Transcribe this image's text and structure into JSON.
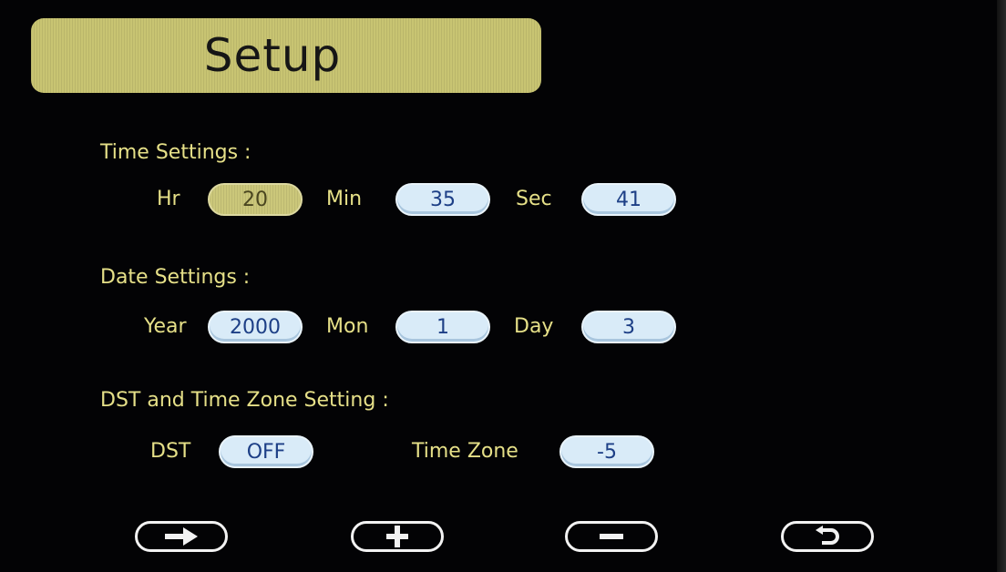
{
  "header": {
    "title": "Setup"
  },
  "time_settings": {
    "label": "Time Settings :",
    "hr_label": "Hr",
    "hr_value": "20",
    "min_label": "Min",
    "min_value": "35",
    "sec_label": "Sec",
    "sec_value": "41"
  },
  "date_settings": {
    "label": "Date Settings :",
    "year_label": "Year",
    "year_value": "2000",
    "mon_label": "Mon",
    "mon_value": "1",
    "day_label": "Day",
    "day_value": "3"
  },
  "dst_settings": {
    "label": "DST and Time Zone Setting :",
    "dst_label": "DST",
    "dst_value": "OFF",
    "tz_label": "Time Zone",
    "tz_value": "-5"
  },
  "selected_field": "hr",
  "nav_buttons": [
    {
      "icon": "arrow-right-icon"
    },
    {
      "icon": "plus-icon"
    },
    {
      "icon": "minus-icon"
    },
    {
      "icon": "return-icon"
    }
  ],
  "colors": {
    "background": "#030305",
    "label": "#e6e088",
    "active_field": "#cbc77a",
    "field": "#d9ebf8",
    "field_text": "#1d3f86"
  }
}
